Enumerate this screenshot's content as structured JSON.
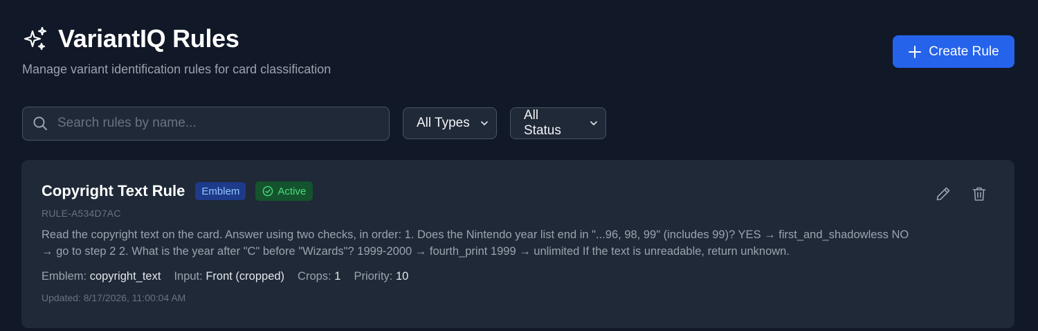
{
  "header": {
    "title": "VariantIQ Rules",
    "subtitle": "Manage variant identification rules for card classification",
    "icon": "sparkles-icon",
    "create_button_label": "Create Rule"
  },
  "filters": {
    "search_placeholder": "Search rules by name...",
    "search_value": "",
    "type_select": "All Types",
    "status_select": "All Status"
  },
  "rules": [
    {
      "name": "Copyright Text Rule",
      "type_badge": "Emblem",
      "status_badge": "Active",
      "id": "RULE-A534D7AC",
      "description": "Read the copyright text on the card. Answer using two checks, in order: 1. Does the Nintendo year list end in \"...96, 98, 99\" (includes 99)? YES → first_and_shadowless NO → go to step 2 2. What is the year after \"C\" before \"Wizards\"? 1999-2000 → fourth_print 1999 → unlimited If the text is unreadable, return unknown.",
      "meta": {
        "emblem_label": "Emblem:",
        "emblem_value": "copyright_text",
        "input_label": "Input:",
        "input_value": "Front (cropped)",
        "crops_label": "Crops:",
        "crops_value": "1",
        "priority_label": "Priority:",
        "priority_value": "10"
      },
      "updated": "Updated: 8/17/2026, 11:00:04 AM"
    }
  ],
  "colors": {
    "background": "#111827",
    "card": "#1f2937",
    "accent": "#2563eb",
    "active": "#4ade80",
    "type_badge": "#93c5fd"
  }
}
